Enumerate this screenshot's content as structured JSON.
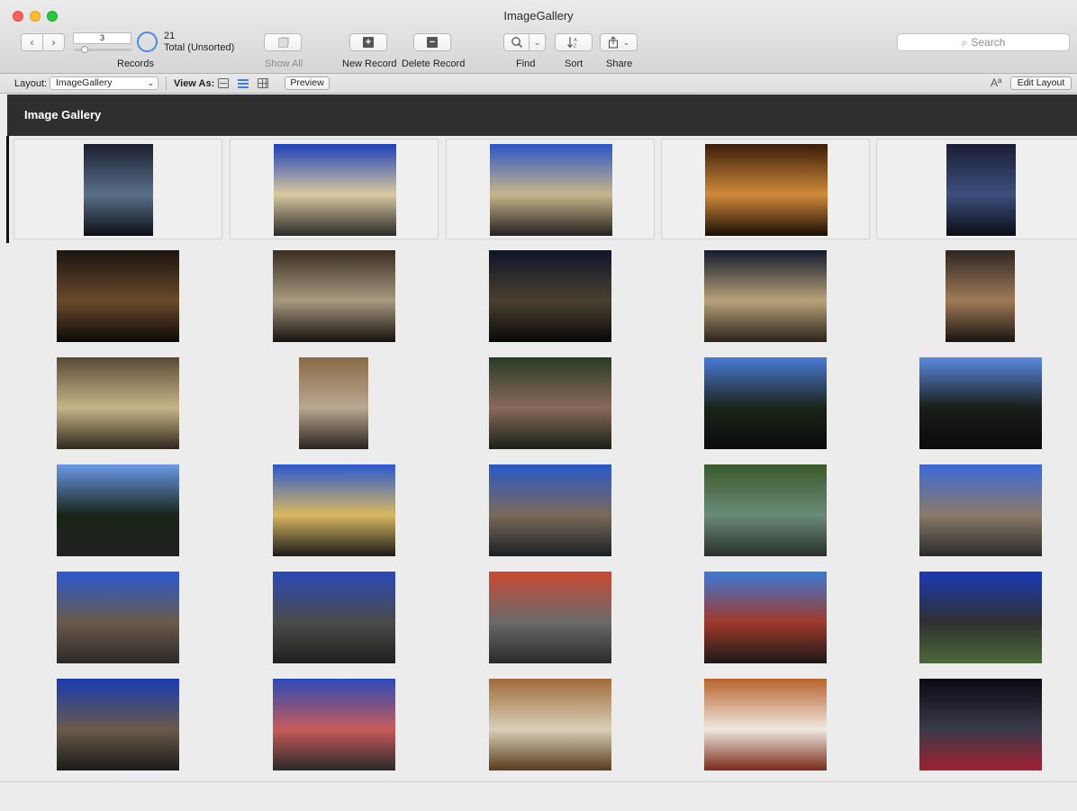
{
  "window": {
    "title": "ImageGallery"
  },
  "toolbar": {
    "record_current": "3",
    "record_total": "21",
    "record_status": "Total (Unsorted)",
    "records_label": "Records",
    "show_all_label": "Show All",
    "new_record_label": "New Record",
    "delete_record_label": "Delete Record",
    "find_label": "Find",
    "sort_label": "Sort",
    "share_label": "Share",
    "search_placeholder": "Search",
    "record_slider_fraction": 0.14
  },
  "layout_bar": {
    "layout_label": "Layout:",
    "layout_value": "ImageGallery",
    "view_as_label": "View As:",
    "view_modes": [
      "form-view-icon",
      "list-view-icon",
      "table-view-icon"
    ],
    "selected_view": "list-view-icon",
    "preview_label": "Preview",
    "text_format_label": "Aª",
    "edit_layout_label": "Edit Layout"
  },
  "header": {
    "title": "Image Gallery"
  },
  "gallery": {
    "rows": [
      {
        "active": true,
        "photos": [
          {
            "orient": "port",
            "c": [
              "#1a1f2e",
              "#5a6f8a",
              "#0e0f14"
            ]
          },
          {
            "orient": "land",
            "c": [
              "#1b3fb8",
              "#d9c9a0",
              "#2a2a2a"
            ]
          },
          {
            "orient": "land",
            "c": [
              "#2b56c8",
              "#c8b68a",
              "#242020"
            ]
          },
          {
            "orient": "land",
            "c": [
              "#3a1c08",
              "#d08a3a",
              "#1a0d05"
            ]
          },
          {
            "orient": "port",
            "c": [
              "#1a1e33",
              "#3c4f7e",
              "#0b0d14"
            ]
          }
        ]
      },
      {
        "active": false,
        "photos": [
          {
            "orient": "land",
            "c": [
              "#1a1410",
              "#6a4a2a",
              "#0c0a08"
            ]
          },
          {
            "orient": "land",
            "c": [
              "#3a2e22",
              "#a89a80",
              "#15110d"
            ]
          },
          {
            "orient": "land",
            "c": [
              "#0e1428",
              "#4a4030",
              "#080808"
            ]
          },
          {
            "orient": "land",
            "c": [
              "#141a2c",
              "#b8a27a",
              "#2a2418"
            ]
          },
          {
            "orient": "port",
            "c": [
              "#2c2622",
              "#a07a58",
              "#1a1410"
            ]
          }
        ]
      },
      {
        "active": false,
        "photos": [
          {
            "orient": "land",
            "c": [
              "#5a4a32",
              "#c8b48a",
              "#30281c"
            ]
          },
          {
            "orient": "port",
            "c": [
              "#8a6a48",
              "#b8a890",
              "#2a2420"
            ]
          },
          {
            "orient": "land",
            "c": [
              "#2a3a24",
              "#8a6a5a",
              "#1a2018"
            ]
          },
          {
            "orient": "land",
            "c": [
              "#4a7ad8",
              "#1a2418",
              "#0a0c0a"
            ]
          },
          {
            "orient": "land",
            "c": [
              "#5a8ae0",
              "#1a1e18",
              "#0a0a0a"
            ]
          }
        ]
      },
      {
        "active": false,
        "photos": [
          {
            "orient": "land",
            "c": [
              "#6a9ae8",
              "#1a2418",
              "#202020"
            ]
          },
          {
            "orient": "land",
            "c": [
              "#2a58d0",
              "#d8b860",
              "#1a1a1a"
            ]
          },
          {
            "orient": "land",
            "c": [
              "#2a58c8",
              "#7a6a5a",
              "#1a2024"
            ]
          },
          {
            "orient": "land",
            "c": [
              "#3a5a2a",
              "#6a8a7a",
              "#2a302a"
            ]
          },
          {
            "orient": "land",
            "c": [
              "#3a6ad8",
              "#8a7a6a",
              "#2a2a2a"
            ]
          }
        ]
      },
      {
        "active": false,
        "photos": [
          {
            "orient": "land",
            "c": [
              "#2a5ad0",
              "#6a5a4a",
              "#2a2a2a"
            ]
          },
          {
            "orient": "land",
            "c": [
              "#2a4ab8",
              "#4a4a48",
              "#202020"
            ]
          },
          {
            "orient": "land",
            "c": [
              "#c84a32",
              "#6a6a6a",
              "#2a2a2a"
            ]
          },
          {
            "orient": "land",
            "c": [
              "#3a7ad8",
              "#a03a2a",
              "#1a1a1a"
            ]
          },
          {
            "orient": "land",
            "c": [
              "#1a3ab8",
              "#303030",
              "#4a6a3a"
            ]
          }
        ]
      },
      {
        "active": false,
        "photos": [
          {
            "orient": "land",
            "c": [
              "#1a3ab0",
              "#6a5a4a",
              "#1a1a1a"
            ]
          },
          {
            "orient": "land",
            "c": [
              "#2a4ab8",
              "#c85a5a",
              "#2a2a2a"
            ]
          },
          {
            "orient": "land",
            "c": [
              "#a06a3a",
              "#d8d0b8",
              "#5a3a1a"
            ]
          },
          {
            "orient": "land",
            "c": [
              "#b8622a",
              "#f0e8e0",
              "#7a2a1a"
            ]
          },
          {
            "orient": "land",
            "c": [
              "#0a0a14",
              "#3a3a4a",
              "#a02030"
            ]
          }
        ]
      }
    ]
  },
  "colors": {
    "accent": "#3b7fe4",
    "header_band": "#2f2f2f",
    "progress_ring": "#4b8bea"
  }
}
